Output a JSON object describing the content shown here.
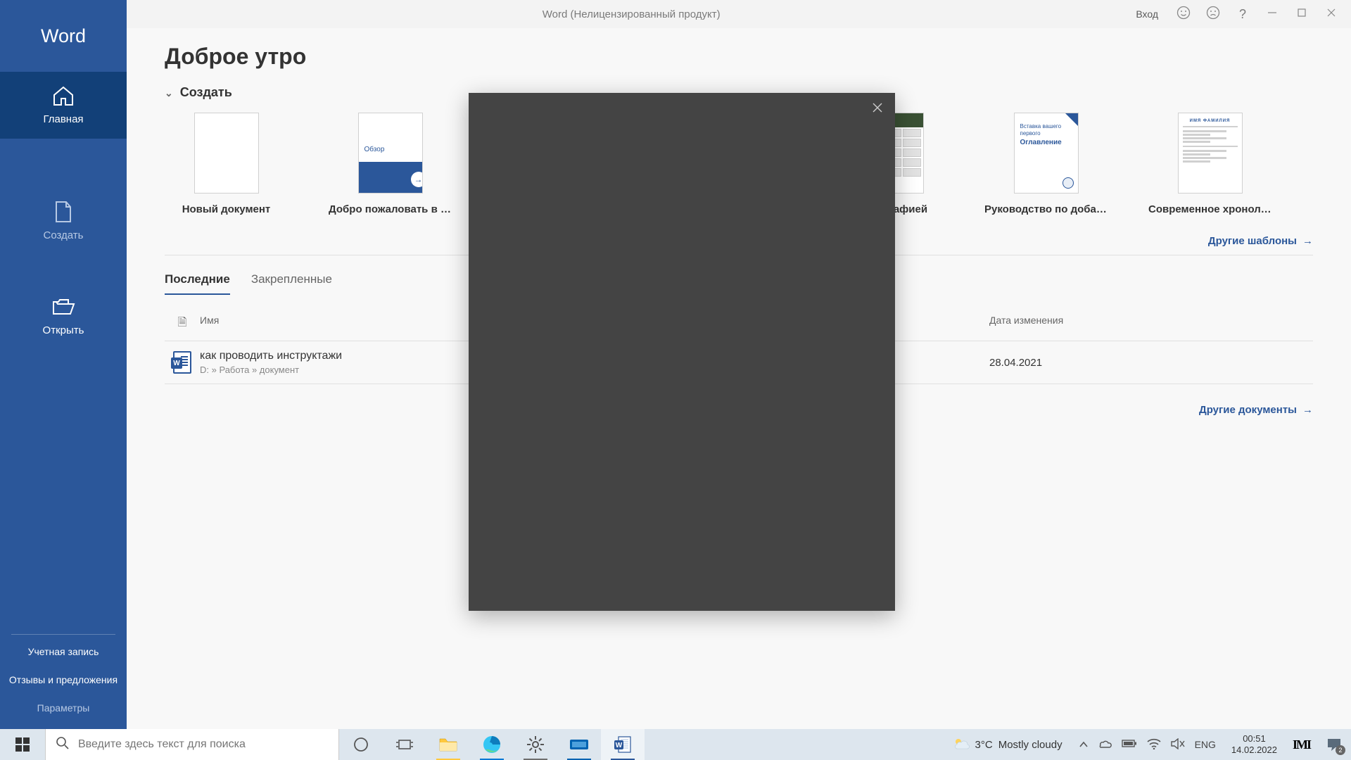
{
  "titlebar": {
    "title": "Word (Нелицензированный продукт)",
    "signin": "Вход"
  },
  "sidebar": {
    "brand": "Word",
    "nav": {
      "home": "Главная",
      "create": "Создать",
      "open": "Открыть"
    },
    "bottom": {
      "account": "Учетная запись",
      "feedback": "Отзывы и предложения",
      "options": "Параметры"
    }
  },
  "content": {
    "greeting": "Доброе утро",
    "create_section": "Создать",
    "templates": [
      {
        "label": "Новый документ"
      },
      {
        "label": "Добро пожаловать в Wo…",
        "overview": "Обзор"
      },
      {
        "label": "…с фотографией"
      },
      {
        "label": "Руководство по добавлен…",
        "l1": "Вставка вашего",
        "l2": "первого",
        "l3": "Оглавление"
      },
      {
        "label": "Современное хронологич…",
        "name_placeholder": "ИМЯ ФАМИЛИЯ"
      }
    ],
    "more_templates": "Другие шаблоны",
    "tabs": {
      "recent": "Последние",
      "pinned": "Закрепленные"
    },
    "list_head": {
      "name": "Имя",
      "date": "Дата изменения"
    },
    "recent": [
      {
        "filename": "как проводить инструктажи",
        "path": "D: » Работа » документ",
        "date": "28.04.2021"
      }
    ],
    "more_docs": "Другие документы"
  },
  "taskbar": {
    "search_placeholder": "Введите здесь текст для поиска",
    "weather": {
      "temp": "3°C",
      "desc": "Mostly cloudy"
    },
    "lang": "ENG",
    "time": "00:51",
    "date": "14.02.2022",
    "ime": "IMI",
    "notif_count": "2"
  }
}
